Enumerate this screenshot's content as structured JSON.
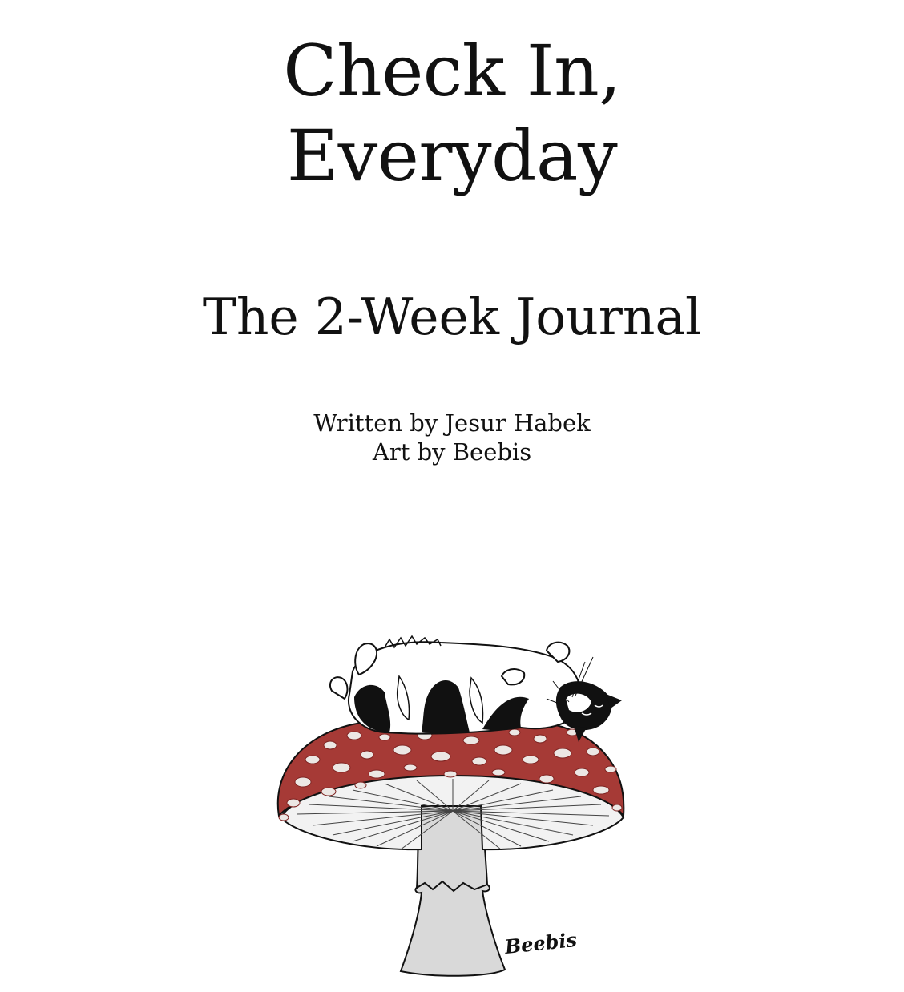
{
  "title": {
    "line1": "Check In,",
    "line2": "Everyday"
  },
  "subtitle": "The 2-Week Journal",
  "credits": {
    "writer": "Written by Jesur Habek",
    "artist": "Art by Beebis"
  },
  "illustration": {
    "icon": "cat-on-mushroom-illustration",
    "signature": "Beebis",
    "colors": {
      "cap": "#a63a36",
      "cap_dark": "#7e2422",
      "spots": "#ece7e4",
      "gills": "#f1f1f1",
      "stem": "#d7d7d7",
      "ink": "#111111"
    }
  }
}
